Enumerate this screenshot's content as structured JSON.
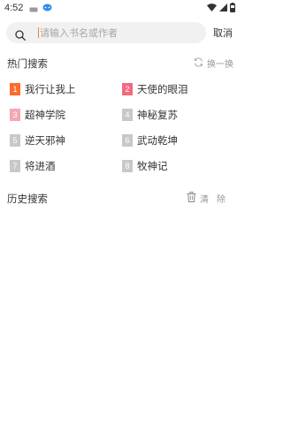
{
  "status_bar": {
    "time": "4:52"
  },
  "search": {
    "placeholder": "请输入书名或作者",
    "value": "",
    "cancel_label": "取消"
  },
  "hot": {
    "title": "热门搜索",
    "refresh_label": "换一换",
    "items": [
      {
        "rank": "1",
        "title": "我行让我上",
        "rank_color": "#ff6a2b"
      },
      {
        "rank": "2",
        "title": "天使的眼泪",
        "rank_color": "#f4697f"
      },
      {
        "rank": "3",
        "title": "超神学院",
        "rank_color": "#f5a7b3"
      },
      {
        "rank": "4",
        "title": "神秘复苏",
        "rank_color": "#c8c8c8"
      },
      {
        "rank": "5",
        "title": "逆天邪神",
        "rank_color": "#c8c8c8"
      },
      {
        "rank": "6",
        "title": "武动乾坤",
        "rank_color": "#c8c8c8"
      },
      {
        "rank": "7",
        "title": "将进酒",
        "rank_color": "#c8c8c8"
      },
      {
        "rank": "8",
        "title": "牧神记",
        "rank_color": "#c8c8c8"
      }
    ]
  },
  "history": {
    "title": "历史搜索",
    "clear_label": "清除"
  },
  "colors": {
    "accent": "#ff7f2a",
    "text": "#333333",
    "muted": "#999999",
    "search_bg": "#f1f1f1"
  }
}
